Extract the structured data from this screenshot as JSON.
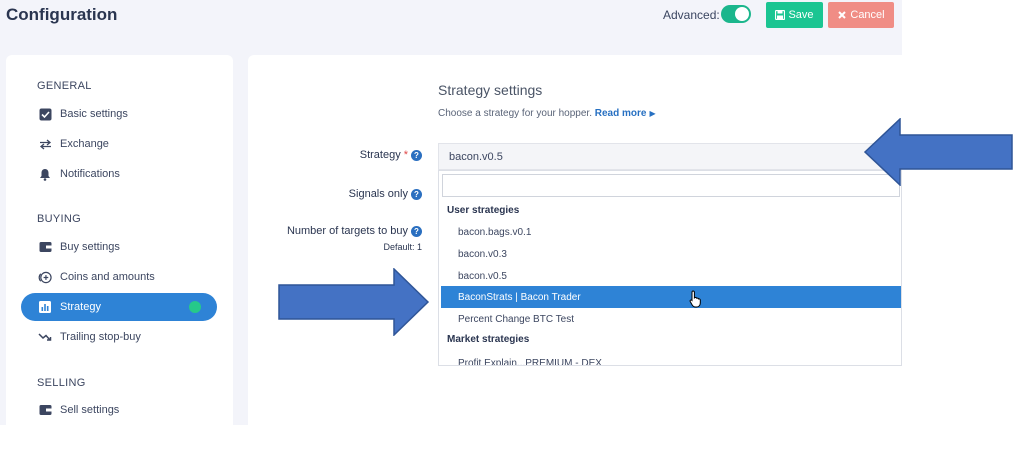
{
  "header": {
    "title": "Configuration",
    "advanced_label": "Advanced:",
    "advanced_enabled": true,
    "save_label": "Save",
    "cancel_label": "Cancel"
  },
  "sidebar": {
    "sections": [
      {
        "title": "GENERAL",
        "items": [
          {
            "label": "Basic settings",
            "icon": "checkbox-icon"
          },
          {
            "label": "Exchange",
            "icon": "exchange-arrows-icon"
          },
          {
            "label": "Notifications",
            "icon": "bell-icon"
          }
        ]
      },
      {
        "title": "BUYING",
        "items": [
          {
            "label": "Buy settings",
            "icon": "wallet-icon"
          },
          {
            "label": "Coins and amounts",
            "icon": "coins-plus-icon"
          },
          {
            "label": "Strategy",
            "icon": "chart-icon",
            "active": true
          },
          {
            "label": "Trailing stop-buy",
            "icon": "trend-down-icon"
          }
        ]
      },
      {
        "title": "SELLING",
        "items": [
          {
            "label": "Sell settings",
            "icon": "wallet-icon"
          }
        ]
      }
    ]
  },
  "main": {
    "title": "Strategy settings",
    "description": "Choose a strategy for your hopper.",
    "read_more": "Read more",
    "fields": {
      "strategy_label": "Strategy",
      "signals_label": "Signals only",
      "targets_label": "Number of targets to buy",
      "targets_default": "Default: 1"
    },
    "strategy_select": {
      "value": "bacon.v0.5",
      "search_value": ""
    },
    "dropdown": {
      "user_group": "User strategies",
      "user_options": [
        "bacon.bags.v0.1",
        "bacon.v0.3",
        "bacon.v0.5",
        "BaconStrats | Bacon Trader",
        "Percent Change BTC Test"
      ],
      "highlighted_index": 3,
      "market_group": "Market strategies",
      "market_partial": "Profit Explain...PREMIUM - DEX"
    }
  },
  "colors": {
    "accent": "#2e83d6",
    "save": "#1bc592",
    "cancel": "#f08d85",
    "annotation_arrow": "#4472c4"
  }
}
